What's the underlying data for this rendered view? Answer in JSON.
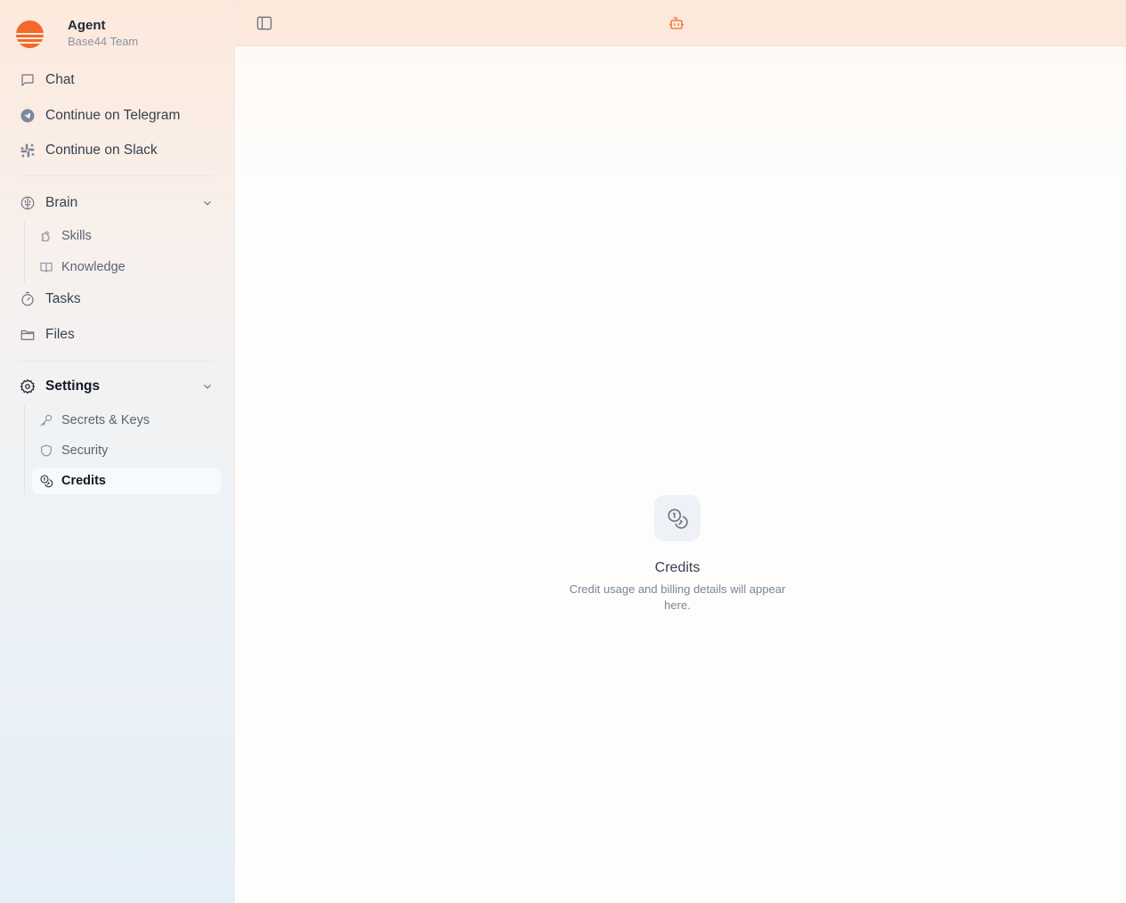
{
  "brand": {
    "name": "Agent",
    "team": "Base44 Team",
    "color": "#f26a2a"
  },
  "nav": {
    "chat": "Chat",
    "telegram": "Continue on Telegram",
    "slack": "Continue on Slack",
    "brain": "Brain",
    "skills": "Skills",
    "knowledge": "Knowledge",
    "tasks": "Tasks",
    "files": "Files",
    "settings": "Settings",
    "secrets": "Secrets & Keys",
    "security": "Security",
    "credits": "Credits"
  },
  "icons": {
    "toggle": "sidebar-toggle-icon",
    "agent": "robot-icon"
  },
  "empty_state": {
    "title": "Credits",
    "description": "Credit usage and billing details will appear here."
  },
  "colors": {
    "accent": "#f26a2a",
    "header_bg": "#fde9dc"
  }
}
